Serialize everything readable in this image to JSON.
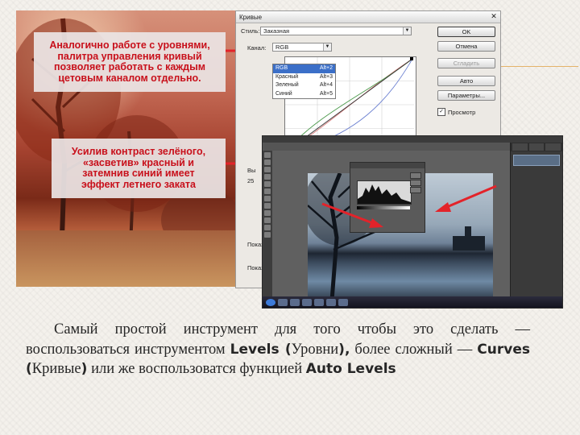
{
  "photo_callouts": {
    "top": "Аналогично работе с уровнями,\nпалитра управления кривый\nпозволяет работать с каждым\nцетовым каналом отдельно.",
    "bottom": "Усилив контраст зелёного,\n«засветив» красный и\nзатемнив синий имеет\nэффект летнего заката"
  },
  "curves_dialog": {
    "title": "Кривые",
    "style_label": "Стиль:",
    "style_value": "Заказная",
    "channel_label": "Канал:",
    "channel_value": "RGB",
    "channel_options": [
      {
        "label": "RGB",
        "shortcut": "Alt+2",
        "selected": true
      },
      {
        "label": "Красный",
        "shortcut": "Alt+3",
        "selected": false
      },
      {
        "label": "Зеленый",
        "shortcut": "Alt+4",
        "selected": false
      },
      {
        "label": "Синий",
        "shortcut": "Alt+5",
        "selected": false
      }
    ],
    "buttons": {
      "ok": "OK",
      "cancel": "Отмена",
      "smooth": "Сгладить",
      "auto": "Авто",
      "params": "Параметры..."
    },
    "preview_label": "Просмотр",
    "preview_checked": true,
    "side_labels": {
      "v": "Вы",
      "n": "25",
      "show1": "Показ",
      "show2": "Показ"
    }
  },
  "caption": {
    "part1": "Самый простой инструмент для того чтобы это сделать — воспользоваться инструментом ",
    "term1": "Levels (",
    "term1_ru": "Уровни",
    "term1_close": "),",
    "part2": " более сложный — ",
    "term2": "Curves (",
    "term2_ru": "Кривые",
    "term2_close": ")",
    "part3": " или же воспользоватся функцией ",
    "term3": "Auto Levels"
  },
  "colors": {
    "callout_text": "#c8101b",
    "arrow": "#e3232a",
    "accent_line": "#e4b36a"
  }
}
